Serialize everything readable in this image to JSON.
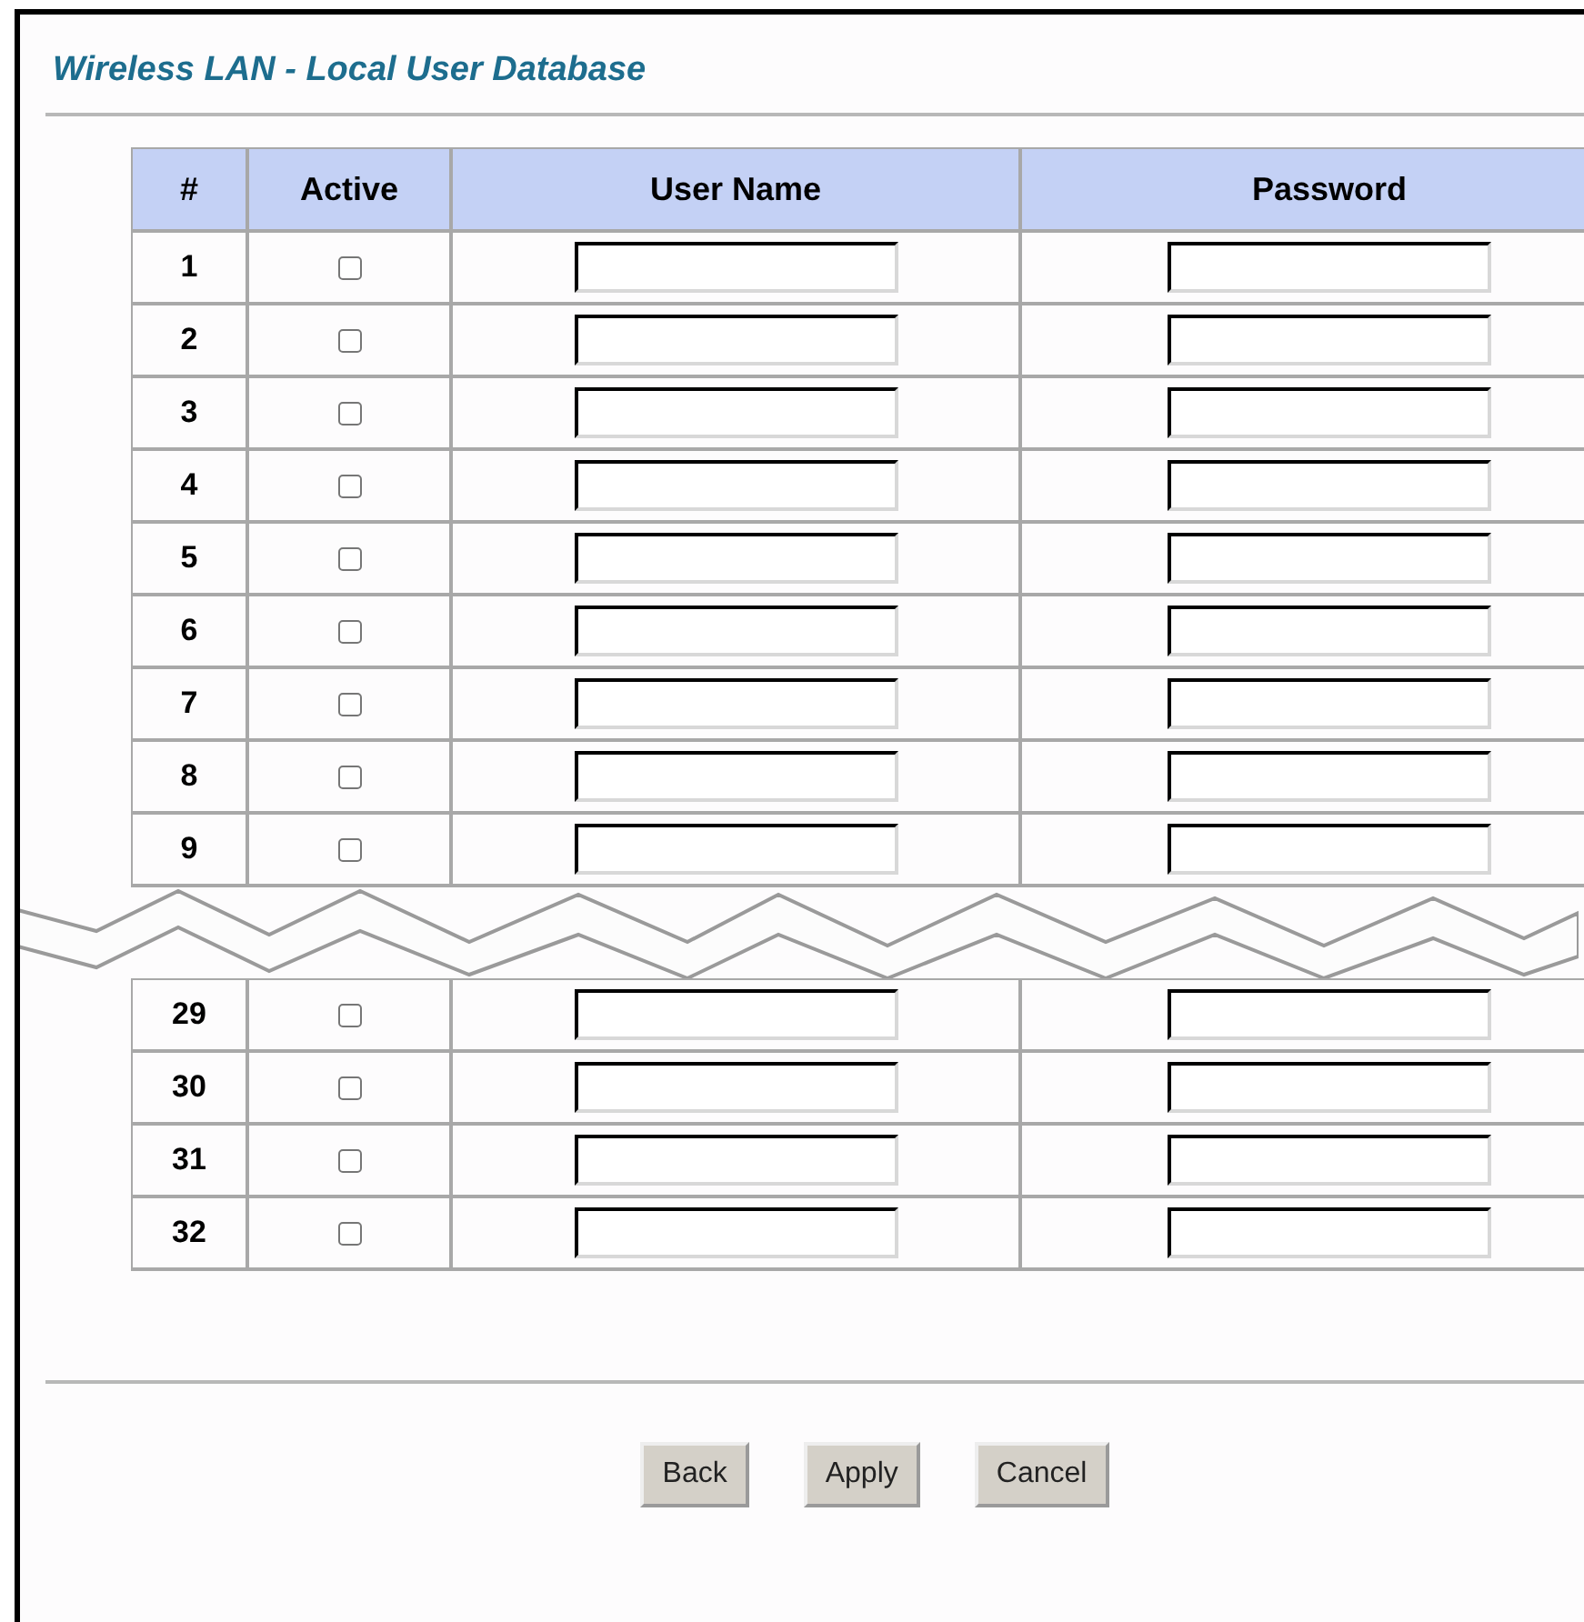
{
  "title": "Wireless LAN - Local User Database",
  "table": {
    "columns": [
      "#",
      "Active",
      "User Name",
      "Password"
    ],
    "rows_top": [
      {
        "number": "1",
        "active": false
      },
      {
        "number": "2",
        "active": false
      },
      {
        "number": "3",
        "active": false
      },
      {
        "number": "4",
        "active": false
      },
      {
        "number": "5",
        "active": false
      },
      {
        "number": "6",
        "active": false
      },
      {
        "number": "7",
        "active": false
      },
      {
        "number": "8",
        "active": false
      },
      {
        "number": "9",
        "active": false
      }
    ],
    "rows_bottom": [
      {
        "number": "29",
        "active": false
      },
      {
        "number": "30",
        "active": false
      },
      {
        "number": "31",
        "active": false
      },
      {
        "number": "32",
        "active": false
      }
    ]
  },
  "buttons": [
    "Back",
    "Apply",
    "Cancel"
  ]
}
